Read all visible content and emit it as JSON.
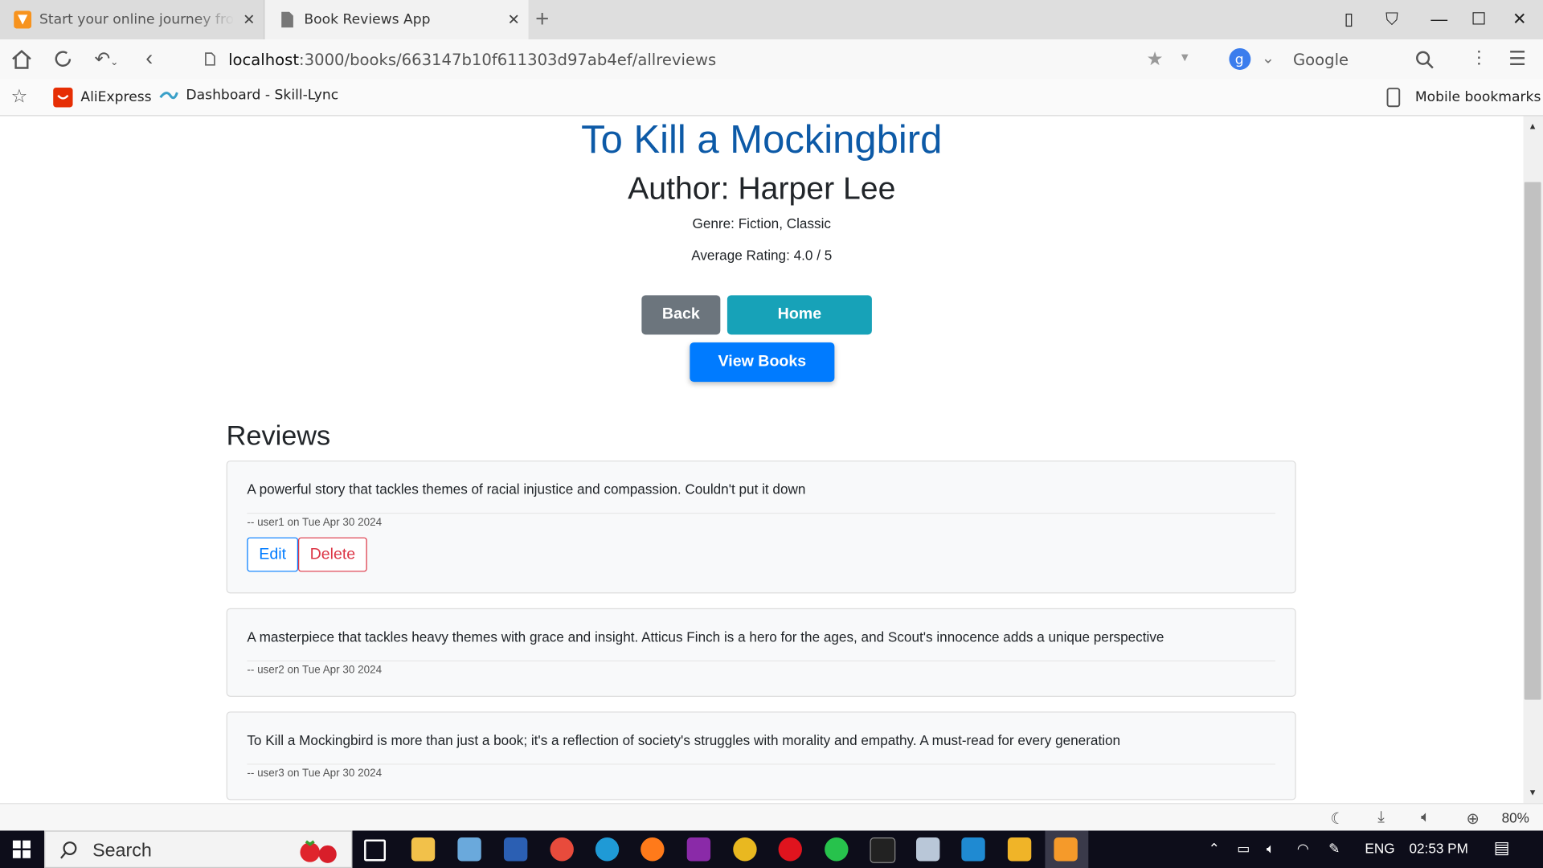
{
  "browser": {
    "tabs": [
      {
        "title": "Start your online journey from"
      },
      {
        "title": "Book Reviews App"
      }
    ],
    "url": {
      "host": "localhost",
      "path": ":3000/books/663147b10f611303d97ab4ef/allreviews"
    },
    "search_engine": "Google",
    "bookmarks": [
      {
        "label": "AliExpress"
      },
      {
        "label": "Dashboard - Skill-Lync"
      }
    ],
    "mobile_bookmarks": "Mobile bookmarks",
    "zoom": "80%"
  },
  "book": {
    "title": "To Kill a Mockingbird",
    "author": "Author: Harper Lee",
    "genre": "Genre: Fiction, Classic",
    "rating": "Average Rating: 4.0 / 5"
  },
  "actions": {
    "back": "Back",
    "home": "Home",
    "view_books": "View Books"
  },
  "reviews": {
    "heading": "Reviews",
    "items": [
      {
        "text": "A powerful story that tackles themes of racial injustice and compassion. Couldn't put it down",
        "meta": "-- user1 on Tue Apr 30 2024",
        "edit": "Edit",
        "delete": "Delete"
      },
      {
        "text": "A masterpiece that tackles heavy themes with grace and insight. Atticus Finch is a hero for the ages, and Scout's innocence adds a unique perspective",
        "meta": "-- user2 on Tue Apr 30 2024"
      },
      {
        "text": "To Kill a Mockingbird is more than just a book; it's a reflection of society's struggles with morality and empathy. A must-read for every generation",
        "meta": "-- user3 on Tue Apr 30 2024"
      }
    ]
  },
  "taskbar": {
    "search": "Search",
    "language": "ENG",
    "time": "02:53 PM"
  },
  "colors": {
    "title_blue": "#0d5aa7",
    "back": "#6c757d",
    "home": "#17a2b8",
    "view_books": "#007bff",
    "danger": "#dc3545"
  }
}
